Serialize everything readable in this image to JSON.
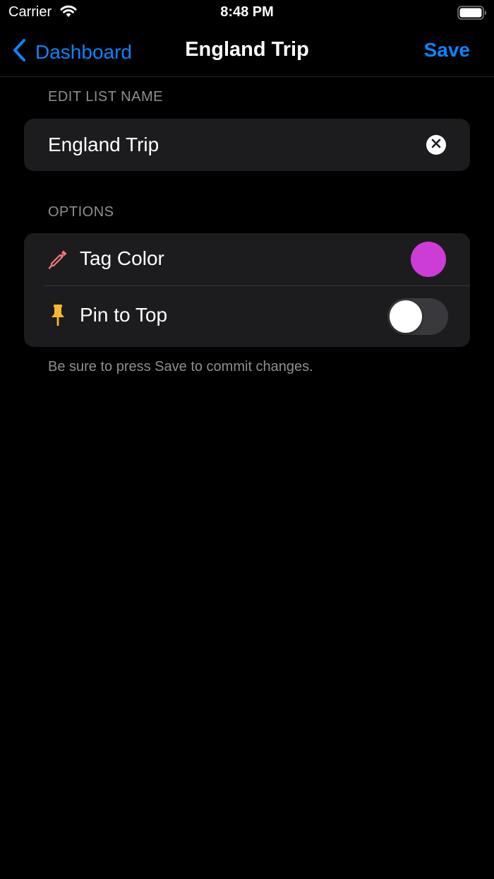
{
  "status_bar": {
    "carrier": "Carrier",
    "time": "8:48 PM",
    "icons": [
      "wifi-icon",
      "battery-icon"
    ]
  },
  "nav": {
    "back_label": "Dashboard",
    "title": "England Trip",
    "save_label": "Save",
    "accent_color": "#0a84ff"
  },
  "edit_section": {
    "header": "EDIT LIST NAME",
    "name_value": "England Trip",
    "clear_icon": "clear-circle-icon"
  },
  "options_section": {
    "header": "OPTIONS",
    "rows": [
      {
        "label": "Tag Color",
        "icon": "eyedropper-icon",
        "icon_color": "#f0787a",
        "swatch_color": "#cc3dd6"
      },
      {
        "label": "Pin to Top",
        "icon": "pin-icon",
        "icon_color": "#f5b82e",
        "toggle_on": false
      }
    ]
  },
  "footer": {
    "note": "Be sure to press Save to commit changes."
  },
  "colors": {
    "background": "#000000",
    "card": "#1c1c1e",
    "secondary_text": "#8e8e93"
  }
}
